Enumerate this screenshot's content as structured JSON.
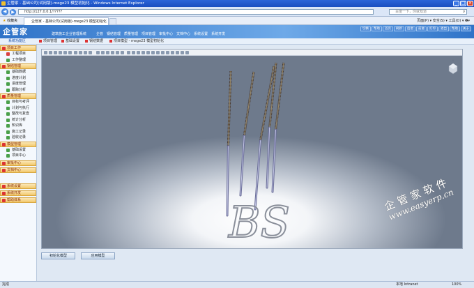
{
  "window": {
    "title": "企管家 - 基础公司(试用版)-mege23 模型初始化 - Windows Internet Explorer",
    "btn_min": "_",
    "btn_max": "□",
    "btn_close": "×"
  },
  "browser": {
    "back": "◀",
    "forward": "▶",
    "address": "http://127.0.0.1/?????",
    "search_placeholder": "百度一下，你就知道",
    "favorites": "收藏夹",
    "tab_title": "企管家 - 基础公司(试用版)-mege23 模型初始化",
    "tools": "页面(P) ▾  安全(S) ▾  工具(O) ▾  ❷▾"
  },
  "app": {
    "logo": "企管家",
    "system_name": "建筑施工企业管理系统",
    "top_menu": [
      "企管",
      "钢结管理",
      "质量管理",
      "项目管理",
      "审批中心",
      "文档中心",
      "系统设置",
      "系统开发"
    ],
    "top_right": [
      "切换",
      "帮助",
      "首页",
      "刷新",
      "后退",
      "前进",
      "打印",
      "退出",
      "帮助",
      "关于"
    ]
  },
  "breadcrumb": {
    "system": "系统功能区",
    "items": [
      "项目管理",
      "基础设置",
      "钢结数据",
      "项目模型 - mege23 模型初始化"
    ]
  },
  "sidebar": [
    {
      "group": "项目工作",
      "items": [
        {
          "label": "工程项目",
          "red": true
        },
        {
          "label": "工作整理",
          "red": false
        }
      ]
    },
    {
      "group": "钢结管理",
      "items": [
        {
          "label": "基础数据",
          "red": false
        },
        {
          "label": "进度计划",
          "red": false
        },
        {
          "label": "进度管理",
          "red": false
        },
        {
          "label": "跟踪分析",
          "red": false
        }
      ]
    },
    {
      "group": "质量管理",
      "items": [
        {
          "label": "目标与考评",
          "red": false
        },
        {
          "label": "计划与执行",
          "red": false
        },
        {
          "label": "整改与复查",
          "red": false
        },
        {
          "label": "统计分析",
          "red": false
        },
        {
          "label": "知识库",
          "red": false
        },
        {
          "label": "施工记录",
          "red": false
        },
        {
          "label": "验收记录",
          "red": false
        }
      ]
    },
    {
      "group": "模型管理",
      "items": [
        {
          "label": "基础设置",
          "red": false
        },
        {
          "label": "项目中心",
          "red": false
        }
      ]
    },
    {
      "group": "审批中心",
      "items": []
    },
    {
      "group": "文档中心",
      "items": []
    },
    {
      "group": "系统设置",
      "items": []
    },
    {
      "group": "系统开发",
      "items": []
    },
    {
      "group": "帮助体系",
      "items": []
    }
  ],
  "viewer": {
    "logo_text": "BS",
    "watermark_line1": "企管家软件",
    "watermark_line2": "www.easyerp.cn"
  },
  "actions": {
    "init_model": "初始化模型",
    "apply_model": "应用模型"
  },
  "status": {
    "left": "完成",
    "zone": "本地 Intranet",
    "zoom": "100%"
  }
}
